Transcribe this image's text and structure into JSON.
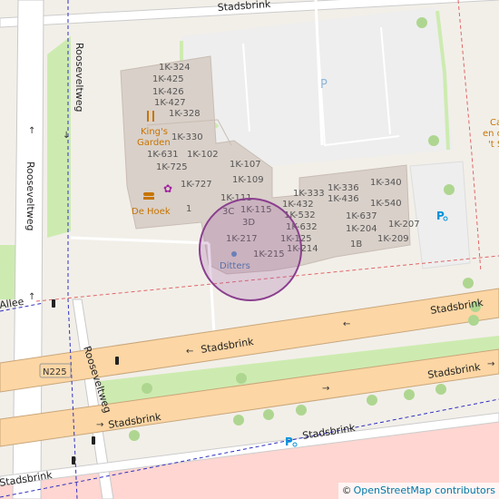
{
  "map": {
    "roads": {
      "stadsbrink_north": "Stadsbrink",
      "stadsbrink_main_a": "Stadsbrink",
      "stadsbrink_main_b": "Stadsbrink",
      "stadsbrink_main_c": "Stadsbrink",
      "stadsbrink_lower_a": "Stadsbrink",
      "stadsbrink_lower_b": "Stadsbrink",
      "stadsbrink_south_a": "Stadsbrink",
      "stadsbrink_south_b": "Stadsbrink",
      "rooseveltweg_a": "Rooseveltweg",
      "rooseveltweg_b": "Rooseveltweg",
      "rooseveltweg_c": "Rooseveltweg",
      "allee": "Allee"
    },
    "route_shield": "N225",
    "parking_label": "P",
    "pois": {
      "kings_garden_line1": "King's",
      "kings_garden_line2": "Garden",
      "de_hoek": "De Hoek",
      "ditters": "Ditters"
    },
    "edge_text": {
      "line1": "Ca",
      "line2": "en c",
      "line3": "'t S"
    },
    "units": {
      "u1": "1K-324",
      "u2": "1K-425",
      "u3": "1K-426",
      "u4": "1K-427",
      "u5": "1K-328",
      "u6": "1K-330",
      "u7": "1K-631",
      "u8": "1K-102",
      "u9": "1K-725",
      "u10": "1K-107",
      "u11": "1K-109",
      "u12": "1K-727",
      "u13": "1K-111",
      "u14": "1",
      "u15": "3C",
      "u16": "1K-115",
      "u17": "3D",
      "u18": "1K-333",
      "u19": "1K-336",
      "u20": "1K-340",
      "u21": "1K-432",
      "u22": "1K-436",
      "u23": "1K-540",
      "u24": "1K-532",
      "u25": "1K-637",
      "u26": "1K-632",
      "u27": "1K-204",
      "u28": "1K-207",
      "u29": "1K-217",
      "u30": "1K-125",
      "u31": "1K-209",
      "u32": "1K-214",
      "u33": "1B",
      "u34": "1K-215"
    },
    "colors": {
      "land": "#f2efe9",
      "building": "#d9d0c9",
      "parking": "#eeeeee",
      "grass": "#cdebb0",
      "trunk": "#fcd6a4",
      "road_casing": "#c9a67a",
      "retail": "#ffd6d1",
      "boundary_red": "#e06666",
      "boundary_blue": "#3030c0",
      "location_circle": "#a05ca5"
    }
  },
  "attribution": {
    "copyright": "©",
    "text": "OpenStreetMap contributors"
  }
}
